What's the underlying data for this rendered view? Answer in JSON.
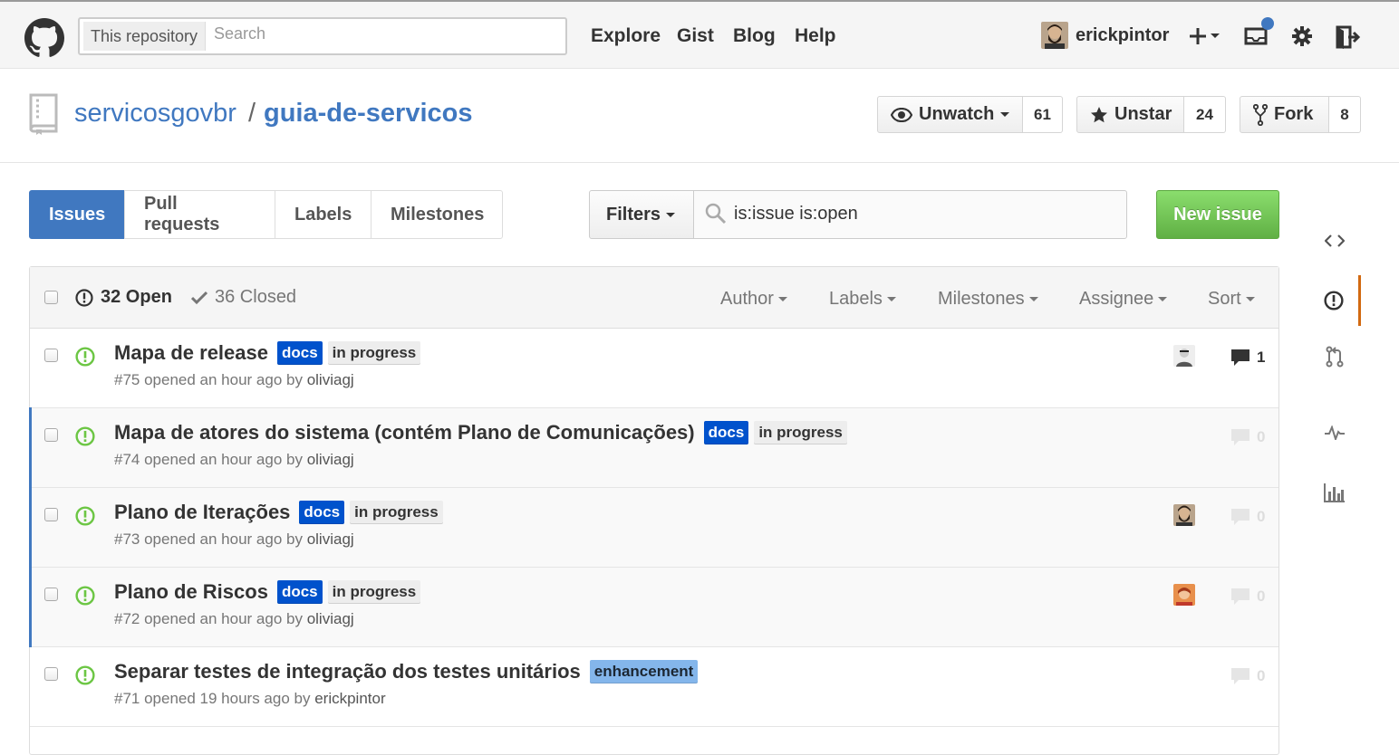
{
  "header": {
    "search_scope": "This repository",
    "search_placeholder": "Search",
    "nav": [
      "Explore",
      "Gist",
      "Blog",
      "Help"
    ],
    "username": "erickpintor"
  },
  "repo": {
    "owner": "servicosgovbr",
    "separator": "/",
    "name": "guia-de-servicos",
    "watch_label": "Unwatch",
    "watch_count": "61",
    "star_label": "Unstar",
    "star_count": "24",
    "fork_label": "Fork",
    "fork_count": "8"
  },
  "subnav": {
    "tabs": [
      "Issues",
      "Pull requests",
      "Labels",
      "Milestones"
    ],
    "active": "Issues",
    "filters_label": "Filters",
    "query": "is:issue is:open",
    "new_issue_label": "New issue"
  },
  "table": {
    "open_label": "32 Open",
    "closed_label": "36 Closed",
    "filters": [
      "Author",
      "Labels",
      "Milestones",
      "Assignee",
      "Sort"
    ]
  },
  "issues": [
    {
      "title": "Mapa de release",
      "labels": [
        "docs",
        "in progress"
      ],
      "meta": "#75 opened an hour ago by",
      "author": "oliviagj",
      "comments": "1",
      "has_assignee": true
    },
    {
      "title": "Mapa de atores do sistema (contém Plano de Comunicações)",
      "labels": [
        "docs",
        "in progress"
      ],
      "meta": "#74 opened an hour ago by",
      "author": "oliviagj",
      "comments": "0",
      "has_assignee": false
    },
    {
      "title": "Plano de Iterações",
      "labels": [
        "docs",
        "in progress"
      ],
      "meta": "#73 opened an hour ago by",
      "author": "oliviagj",
      "comments": "0",
      "has_assignee": true
    },
    {
      "title": "Plano de Riscos",
      "labels": [
        "docs",
        "in progress"
      ],
      "meta": "#72 opened an hour ago by",
      "author": "oliviagj",
      "comments": "0",
      "has_assignee": true
    },
    {
      "title": "Separar testes de integração dos testes unitários",
      "labels": [
        "enhancement"
      ],
      "meta": "#71 opened 19 hours ago by",
      "author": "erickpintor",
      "comments": "0",
      "has_assignee": false
    }
  ],
  "colors": {
    "accent": "#4078c0",
    "open_issue": "#6cc644",
    "docs_label": "#0052cc",
    "in_progress_label": "#ededed",
    "enhancement_label": "#84b6eb",
    "new_issue_button": "#60b044",
    "sidebar_selected": "#d26911"
  },
  "sidebar_icons": [
    "code-icon",
    "issue-icon",
    "pull-request-icon",
    "pulse-icon",
    "graphs-icon"
  ]
}
